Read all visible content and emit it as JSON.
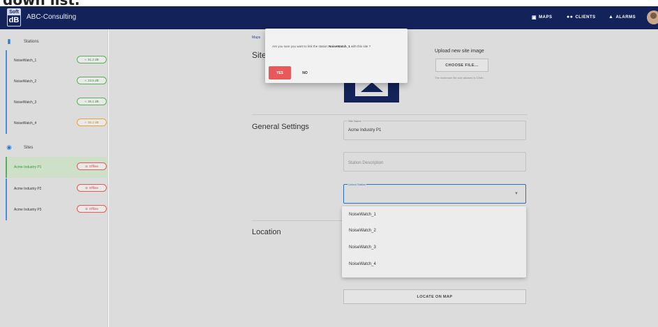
{
  "cropped_caption": "down list.",
  "appbar": {
    "logo_top": "Soft",
    "logo_bottom": "dB",
    "org_name": "ABC-Consulting",
    "nav": [
      {
        "label": "MAPS",
        "icon": "map-icon"
      },
      {
        "label": "CLIENTS",
        "icon": "clients-icon"
      },
      {
        "label": "ALARMS",
        "icon": "bell-icon"
      }
    ]
  },
  "sidebar": {
    "stations_heading": "Stations",
    "stations": [
      {
        "name": "NoiseWatch_1",
        "status": "51.2 dB",
        "color": "green"
      },
      {
        "name": "NoiseWatch_2",
        "status": "23.5 dB",
        "color": "green"
      },
      {
        "name": "NoiseWatch_3",
        "status": "36.1 dB",
        "color": "green"
      },
      {
        "name": "NoiseWatch_4",
        "status": "55.2 dB",
        "color": "orange"
      }
    ],
    "sites_heading": "Sites",
    "sites": [
      {
        "name": "Acme Industry P1",
        "status": "Offline",
        "active": true
      },
      {
        "name": "Acme Industry P2",
        "status": "Offline",
        "active": false
      },
      {
        "name": "Acme Industry P3",
        "status": "Offline",
        "active": false
      }
    ]
  },
  "main": {
    "breadcrumb": "Maps",
    "site_title": "Site",
    "upload_title": "Upload new site image",
    "choose_file_label": "CHOOSE FILE...",
    "upload_note": "The maximum file size allowed is 10Mb.",
    "general_settings_title": "General Settings",
    "site_name_label": "Site Name",
    "site_name_value": "Acme Industry P1",
    "description_placeholder": "Station Description",
    "linked_station_label": "Linked Station",
    "location_title": "Location",
    "locate_label": "LOCATE ON MAP"
  },
  "dropdown": {
    "options": [
      "NoiseWatch_1",
      "NoiseWatch_2",
      "NoiseWatch_3",
      "NoiseWatch_4"
    ]
  },
  "dialog": {
    "msg_pre": "Are you sure you want to link the station ",
    "msg_station": "NoiseWatch_1",
    "msg_post": " with this site ?",
    "yes_label": "YES",
    "no_label": "NO"
  },
  "colors": {
    "appbar": "#13235a",
    "accent_blue": "#2a6fc0",
    "yes_red": "#e85a5a",
    "status_green": "#5cae5c",
    "status_orange": "#e9a23a",
    "status_red": "#e25a5a"
  }
}
